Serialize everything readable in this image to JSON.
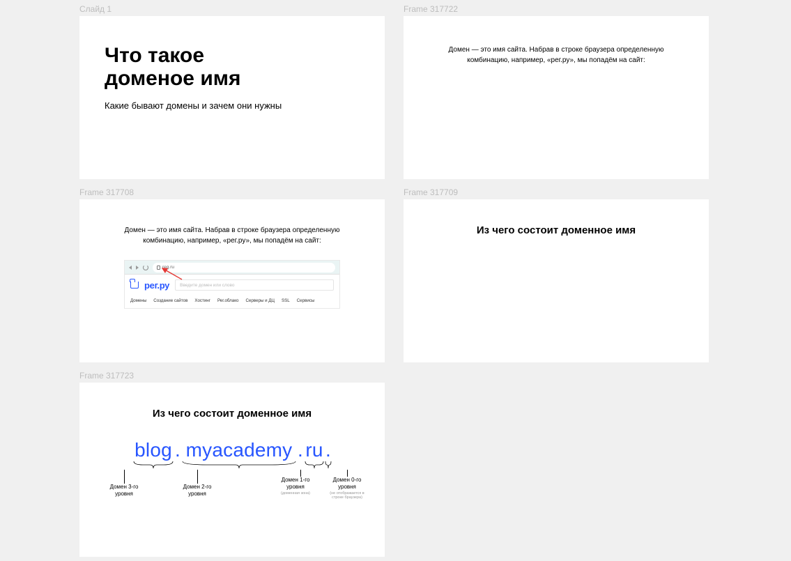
{
  "labels": {
    "slide1": "Слайд 1",
    "frame2": "Frame 317722",
    "frame3": "Frame 317708",
    "frame4": "Frame 317709",
    "frame5": "Frame 317723"
  },
  "slide1": {
    "title_l1": "Что такое",
    "title_l2": "доменое имя",
    "subtitle": "Какие бывают домены и зачем они нужны"
  },
  "slide2": {
    "desc": "Домен — это имя сайта. Набрав в строке браузера определенную комбинацию, например, «рег.ру», мы попадём на сайт:"
  },
  "slide3": {
    "desc": "Домен — это имя сайта. Набрав в строке браузера определенную комбинацию, например, «рег.ру», мы попадём на сайт:",
    "url": "reg.ru",
    "logo": "рег.ру",
    "search_placeholder": "Введите домен или слово",
    "nav": [
      "Домены",
      "Создание сайтов",
      "Хостинг",
      "Рег.облако",
      "Серверы и ДЦ",
      "SSL",
      "Сервисы"
    ]
  },
  "slide4": {
    "heading": "Из чего состоит доменное имя"
  },
  "slide5": {
    "heading": "Из чего состоит доменное имя",
    "domain_parts": [
      "blog",
      ".",
      "myacademy",
      ".",
      "ru",
      "."
    ],
    "segments": [
      {
        "label_l1": "Домен 3-го",
        "label_l2": "уровня",
        "note": ""
      },
      {
        "label_l1": "Домен 2-го",
        "label_l2": "уровня",
        "note": ""
      },
      {
        "label_l1": "Домен 1-го",
        "label_l2": "уровня",
        "note": "(доменная зона)"
      },
      {
        "label_l1": "Домен 0-го",
        "label_l2": "уровня",
        "note": "(не отображается в строке браузера)"
      }
    ]
  }
}
